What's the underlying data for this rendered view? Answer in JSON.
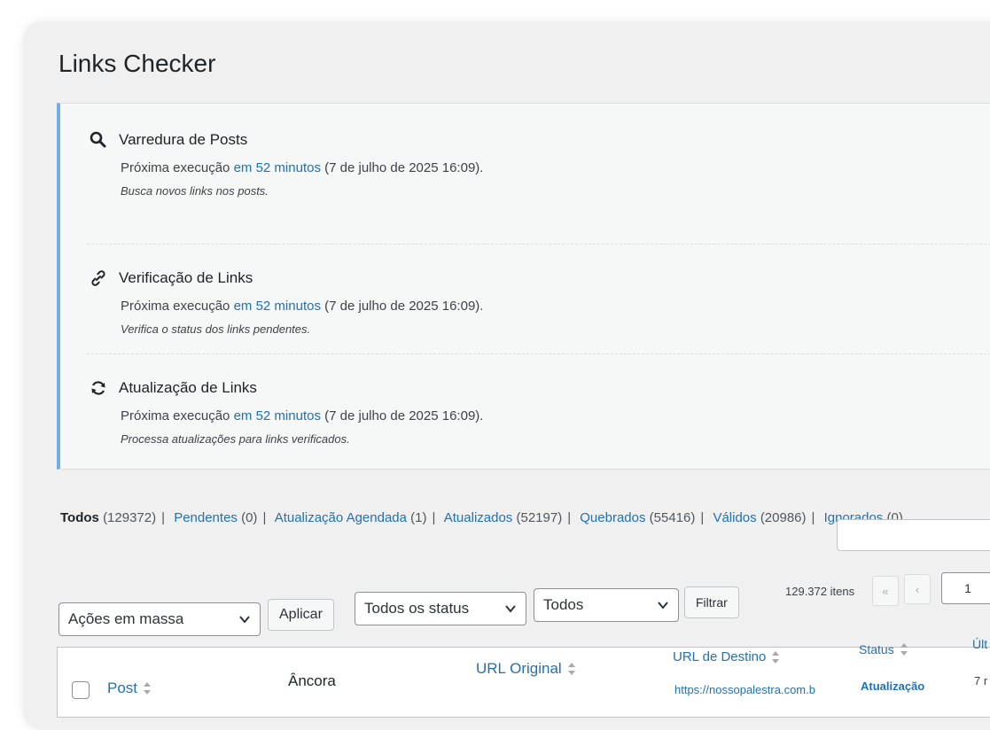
{
  "page": {
    "title": "Links Checker"
  },
  "schedule": {
    "tasks": [
      {
        "icon": "search-icon",
        "name": "Varredura de Posts",
        "next_prefix": "Próxima execução",
        "next_relative": "em 52 minutos",
        "next_absolute": "(7 de julho de 2025 16:09).",
        "description": "Busca novos links nos posts."
      },
      {
        "icon": "link-icon",
        "name": "Verificação de Links",
        "next_prefix": "Próxima execução",
        "next_relative": "em 52 minutos",
        "next_absolute": "(7 de julho de 2025 16:09).",
        "description": "Verifica o status dos links pendentes."
      },
      {
        "icon": "refresh-icon",
        "name": "Atualização de Links",
        "next_prefix": "Próxima execução",
        "next_relative": "em 52 minutos",
        "next_absolute": "(7 de julho de 2025 16:09).",
        "description": "Processa atualizações para links verificados."
      }
    ]
  },
  "filters": [
    {
      "label": "Todos",
      "count": "(129372)",
      "current": true
    },
    {
      "label": "Pendentes",
      "count": "(0)"
    },
    {
      "label": "Atualização Agendada",
      "count": "(1)"
    },
    {
      "label": "Atualizados",
      "count": "(52197)"
    },
    {
      "label": "Quebrados",
      "count": "(55416)"
    },
    {
      "label": "Válidos",
      "count": "(20986)"
    },
    {
      "label": "Ignorados",
      "count": "(0)"
    }
  ],
  "controls": {
    "bulk_actions": "Ações em massa",
    "apply": "Aplicar",
    "status_filter": "Todos os status",
    "type_filter": "Todos",
    "filter": "Filtrar",
    "items_count": "129.372 itens",
    "first_page": "«",
    "prev_page": "‹",
    "current_page": "1"
  },
  "table": {
    "columns": {
      "post": "Post",
      "anchor": "Âncora",
      "url_original": "URL Original",
      "url_destino": "URL de Destino",
      "status": "Status",
      "last": "Últ"
    },
    "first_row": {
      "url_destino": "https://nossopalestra.com.b",
      "status": "Atualização",
      "last": "7 r"
    }
  }
}
